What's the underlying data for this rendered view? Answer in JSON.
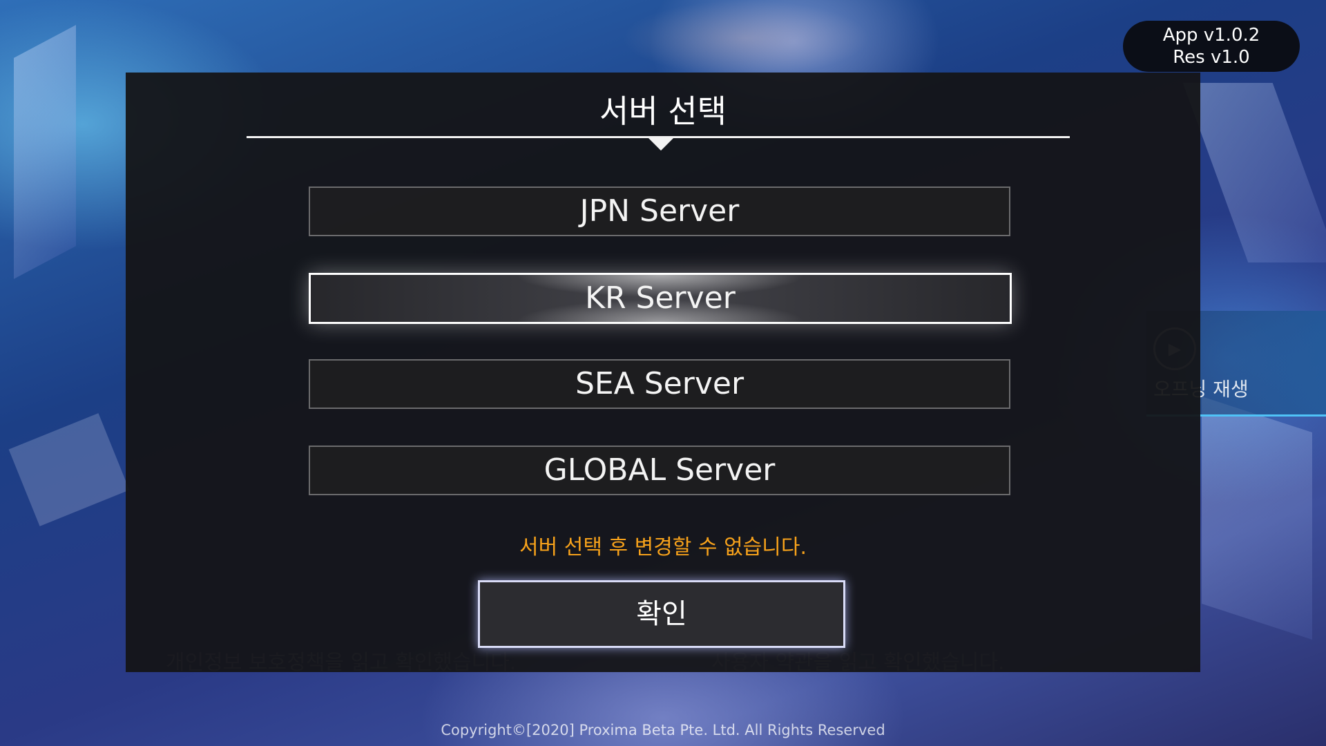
{
  "version": {
    "app": "App v1.0.2",
    "res": "Res v1.0"
  },
  "opening": {
    "label": "오프닝 재생",
    "icon": "play-icon"
  },
  "consent": {
    "privacy": "개인정보 보호정책을 읽고 확인했습니다.",
    "terms": "사용자 약관을 읽고 확인했습니다."
  },
  "modal": {
    "title": "서버 선택",
    "servers": [
      {
        "label": "JPN Server",
        "selected": false
      },
      {
        "label": "KR Server",
        "selected": true
      },
      {
        "label": "SEA Server",
        "selected": false
      },
      {
        "label": "GLOBAL Server",
        "selected": false
      }
    ],
    "warning": "서버 선택 후 변경할 수 없습니다.",
    "confirm_label": "확인"
  },
  "footer": {
    "copyright": "Copyright©[2020] Proxima Beta Pte. Ltd. All Rights Reserved"
  },
  "colors": {
    "warning": "#f7a21b",
    "accent": "#4fc3f7"
  }
}
